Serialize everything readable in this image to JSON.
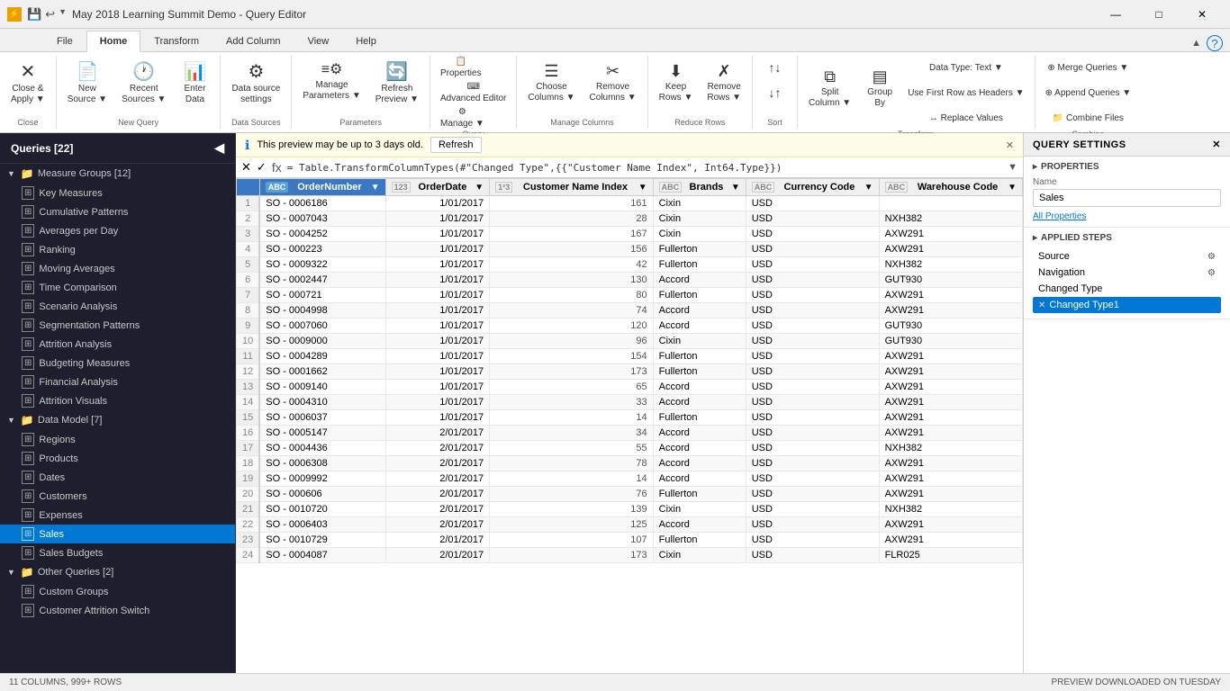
{
  "titleBar": {
    "icon": "PBI",
    "title": "May 2018 Learning Summit Demo - Query Editor",
    "controls": [
      "—",
      "□",
      "✕"
    ]
  },
  "ribbonTabs": [
    "File",
    "Home",
    "Transform",
    "Add Column",
    "View",
    "Help"
  ],
  "activeTab": "Home",
  "ribbonGroups": [
    {
      "name": "Close",
      "items": [
        {
          "label": "Close &\nApply",
          "icon": "✕",
          "type": "big"
        }
      ]
    },
    {
      "name": "New Query",
      "items": [
        {
          "label": "New\nSource",
          "icon": "📄",
          "type": "big"
        },
        {
          "label": "Recent\nSources",
          "icon": "🕐",
          "type": "big"
        },
        {
          "label": "Enter\nData",
          "icon": "📊",
          "type": "big"
        }
      ]
    },
    {
      "name": "Data Sources",
      "items": [
        {
          "label": "Data source\nsettings",
          "icon": "🔧",
          "type": "big"
        }
      ]
    },
    {
      "name": "Parameters",
      "items": [
        {
          "label": "Manage\nParameters",
          "icon": "⚙",
          "type": "big"
        },
        {
          "label": "Refresh\nPreview",
          "icon": "🔄",
          "type": "big"
        }
      ]
    },
    {
      "name": "Query",
      "items": [
        {
          "label": "Properties",
          "icon": "📋",
          "type": "small"
        },
        {
          "label": "Advanced Editor",
          "icon": "⌨",
          "type": "small"
        },
        {
          "label": "Manage ▼",
          "icon": "⚙",
          "type": "small"
        }
      ]
    },
    {
      "name": "Manage Columns",
      "items": [
        {
          "label": "Choose\nColumns",
          "icon": "☰",
          "type": "big"
        },
        {
          "label": "Remove\nColumns",
          "icon": "✂",
          "type": "big"
        }
      ]
    },
    {
      "name": "Reduce Rows",
      "items": [
        {
          "label": "Keep\nRows",
          "icon": "⬇",
          "type": "big"
        },
        {
          "label": "Remove\nRows",
          "icon": "✗",
          "type": "big"
        }
      ]
    },
    {
      "name": "Sort",
      "items": [
        {
          "label": "↑",
          "icon": "↑",
          "type": "sort"
        },
        {
          "label": "↓",
          "icon": "↓",
          "type": "sort"
        }
      ]
    },
    {
      "name": "Transform",
      "items": [
        {
          "label": "Split\nColumn",
          "icon": "⧉",
          "type": "big"
        },
        {
          "label": "Group\nBy",
          "icon": "▤",
          "type": "big"
        },
        {
          "label": "Data Type: Text ▼",
          "icon": "",
          "type": "small"
        },
        {
          "label": "Use First Row as Headers ▼",
          "icon": "",
          "type": "small"
        },
        {
          "label": "↔ Replace Values",
          "icon": "",
          "type": "small"
        }
      ]
    },
    {
      "name": "Combine",
      "items": [
        {
          "label": "Merge Queries ▼",
          "icon": "",
          "type": "small"
        },
        {
          "label": "Append Queries ▼",
          "icon": "",
          "type": "small"
        },
        {
          "label": "Combine Files",
          "icon": "",
          "type": "small"
        }
      ]
    }
  ],
  "sidebar": {
    "title": "Queries [22]",
    "groups": [
      {
        "name": "Measure Groups [12]",
        "expanded": true,
        "items": [
          "Key Measures",
          "Cumulative Patterns",
          "Averages per Day",
          "Ranking",
          "Moving Averages",
          "Time Comparison",
          "Scenario Analysis",
          "Segmentation Patterns",
          "Attrition Analysis",
          "Budgeting Measures",
          "Financial Analysis",
          "Attrition Visuals"
        ]
      },
      {
        "name": "Data Model [7]",
        "expanded": true,
        "items": [
          "Regions",
          "Products",
          "Dates",
          "Customers",
          "Expenses",
          "Sales",
          "Sales Budgets"
        ]
      },
      {
        "name": "Other Queries [2]",
        "expanded": true,
        "items": [
          "Custom Groups",
          "Customer Attrition Switch"
        ]
      }
    ],
    "activeItem": "Sales"
  },
  "infoBar": {
    "message": "This preview may be up to 3 days old.",
    "refresh": "Refresh"
  },
  "formulaBar": {
    "formula": "= Table.TransformColumnTypes(#\"Changed Type\",{{\"Customer Name Index\", Int64.Type}})"
  },
  "tableColumns": [
    {
      "name": "OrderNumber",
      "type": "ABC",
      "highlighted": true
    },
    {
      "name": "OrderDate",
      "type": "123"
    },
    {
      "name": "Customer Name Index",
      "type": "123"
    },
    {
      "name": "Brands",
      "type": "ABC"
    },
    {
      "name": "Currency Code",
      "type": "ABC"
    },
    {
      "name": "Warehouse Code",
      "type": "ABC"
    }
  ],
  "tableRows": [
    [
      1,
      "SO - 0006186",
      "1/01/2017",
      161,
      "Cixin",
      "USD",
      ""
    ],
    [
      2,
      "SO - 0007043",
      "1/01/2017",
      28,
      "Cixin",
      "USD",
      "NXH382"
    ],
    [
      3,
      "SO - 0004252",
      "1/01/2017",
      167,
      "Cixin",
      "USD",
      "AXW291"
    ],
    [
      4,
      "SO - 000223",
      "1/01/2017",
      156,
      "Fullerton",
      "USD",
      "AXW291"
    ],
    [
      5,
      "SO - 0009322",
      "1/01/2017",
      42,
      "Fullerton",
      "USD",
      "NXH382"
    ],
    [
      6,
      "SO - 0002447",
      "1/01/2017",
      130,
      "Accord",
      "USD",
      "GUT930"
    ],
    [
      7,
      "SO - 000721",
      "1/01/2017",
      80,
      "Fullerton",
      "USD",
      "AXW291"
    ],
    [
      8,
      "SO - 0004998",
      "1/01/2017",
      74,
      "Accord",
      "USD",
      "AXW291"
    ],
    [
      9,
      "SO - 0007060",
      "1/01/2017",
      120,
      "Accord",
      "USD",
      "GUT930"
    ],
    [
      10,
      "SO - 0009000",
      "1/01/2017",
      96,
      "Cixin",
      "USD",
      "GUT930"
    ],
    [
      11,
      "SO - 0004289",
      "1/01/2017",
      154,
      "Fullerton",
      "USD",
      "AXW291"
    ],
    [
      12,
      "SO - 0001662",
      "1/01/2017",
      173,
      "Fullerton",
      "USD",
      "AXW291"
    ],
    [
      13,
      "SO - 0009140",
      "1/01/2017",
      65,
      "Accord",
      "USD",
      "AXW291"
    ],
    [
      14,
      "SO - 0004310",
      "1/01/2017",
      33,
      "Accord",
      "USD",
      "AXW291"
    ],
    [
      15,
      "SO - 0006037",
      "1/01/2017",
      14,
      "Fullerton",
      "USD",
      "AXW291"
    ],
    [
      16,
      "SO - 0005147",
      "2/01/2017",
      34,
      "Accord",
      "USD",
      "AXW291"
    ],
    [
      17,
      "SO - 0004436",
      "2/01/2017",
      55,
      "Accord",
      "USD",
      "NXH382"
    ],
    [
      18,
      "SO - 0006308",
      "2/01/2017",
      78,
      "Accord",
      "USD",
      "AXW291"
    ],
    [
      19,
      "SO - 0009992",
      "2/01/2017",
      14,
      "Accord",
      "USD",
      "AXW291"
    ],
    [
      20,
      "SO - 000606",
      "2/01/2017",
      76,
      "Fullerton",
      "USD",
      "AXW291"
    ],
    [
      21,
      "SO - 0010720",
      "2/01/2017",
      139,
      "Cixin",
      "USD",
      "NXH382"
    ],
    [
      22,
      "SO - 0006403",
      "2/01/2017",
      125,
      "Accord",
      "USD",
      "AXW291"
    ],
    [
      23,
      "SO - 0010729",
      "2/01/2017",
      107,
      "Fullerton",
      "USD",
      "AXW291"
    ],
    [
      24,
      "SO - 0004087",
      "2/01/2017",
      173,
      "Cixin",
      "USD",
      "FLR025"
    ]
  ],
  "querySettings": {
    "title": "QUERY SETTINGS",
    "properties": {
      "title": "PROPERTIES",
      "nameLabel": "Name",
      "nameValue": "Sales",
      "allPropertiesLink": "All Properties"
    },
    "appliedSteps": {
      "title": "APPLIED STEPS",
      "steps": [
        {
          "label": "Source",
          "hasGear": true,
          "hasX": false,
          "active": false
        },
        {
          "label": "Navigation",
          "hasGear": true,
          "hasX": false,
          "active": false
        },
        {
          "label": "Changed Type",
          "hasGear": false,
          "hasX": false,
          "active": false
        },
        {
          "label": "Changed Type1",
          "hasGear": false,
          "hasX": true,
          "active": true
        }
      ]
    }
  },
  "statusBar": {
    "rowsInfo": "11 COLUMNS, 999+ ROWS",
    "previewInfo": "PREVIEW DOWNLOADED ON TUESDAY"
  }
}
